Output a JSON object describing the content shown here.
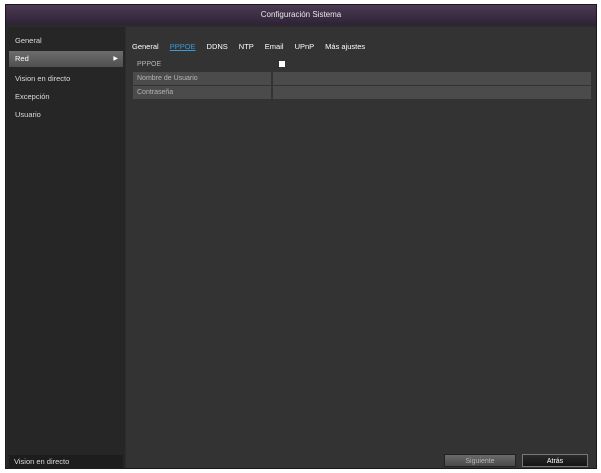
{
  "window": {
    "title": "Configuración Sistema"
  },
  "sidebar": {
    "items": [
      {
        "label": "General"
      },
      {
        "label": "Red",
        "arrow": "▶"
      },
      {
        "label": "Vision en directo"
      },
      {
        "label": "Excepción"
      },
      {
        "label": "Usuario"
      }
    ],
    "bottom_label": "Vision en directo"
  },
  "tabs": [
    {
      "label": "General"
    },
    {
      "label": "PPPOE"
    },
    {
      "label": "DDNS"
    },
    {
      "label": "NTP"
    },
    {
      "label": "Email"
    },
    {
      "label": "UPnP"
    },
    {
      "label": "Más ajustes"
    }
  ],
  "form": {
    "pppoe_label": "PPPOE",
    "pppoe_enabled": false,
    "username_label": "Nombre de Usuario",
    "username_value": "",
    "password_label": "Contraseña",
    "password_value": ""
  },
  "buttons": {
    "next": "Siguiente",
    "back": "Atrás"
  },
  "colors": {
    "accent": "#3a9ad9",
    "title_bar": "#3d2e45",
    "background": "#333333"
  }
}
